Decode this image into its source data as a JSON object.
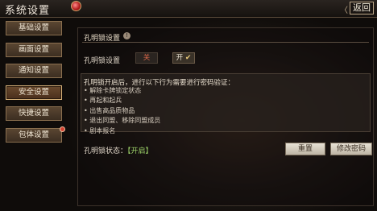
{
  "header": {
    "title": "系统设置",
    "back_label": "返回",
    "back_arrow": "〈"
  },
  "sidebar": {
    "items": [
      {
        "label": "基础设置"
      },
      {
        "label": "画面设置"
      },
      {
        "label": "通知设置"
      },
      {
        "label": "安全设置"
      },
      {
        "label": "快捷设置"
      },
      {
        "label": "包体设置"
      }
    ]
  },
  "panel": {
    "title": "孔明锁设置",
    "info_icon": "!",
    "lock": {
      "label": "孔明锁设置",
      "off_label": "关",
      "on_label": "开",
      "selected": "开"
    },
    "notice": {
      "heading": "孔明锁开启后，进行以下行为需要进行密码验证：",
      "bullets": [
        "解除卡牌锁定状态",
        "再起和起兵",
        "出售高品质物品",
        "退出同盟、移除同盟成员",
        "剧本报名"
      ]
    },
    "status": {
      "label": "孔明锁状态：",
      "value": "【开启】"
    },
    "buttons": {
      "reset": "重置",
      "change_password": "修改密码"
    }
  },
  "colors": {
    "accent": "#d8b27a",
    "status_on": "#9ed46a",
    "badge": "#d24030"
  }
}
